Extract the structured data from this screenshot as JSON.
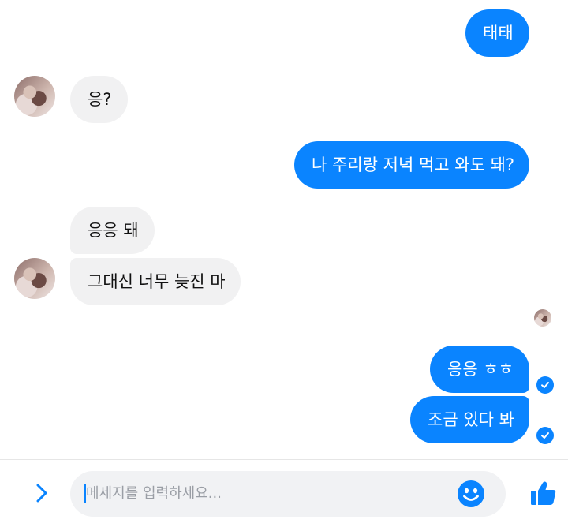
{
  "messages": [
    {
      "id": "m1",
      "direction": "outgoing",
      "text": "태태"
    },
    {
      "id": "m2",
      "direction": "incoming",
      "text": "응?"
    },
    {
      "id": "m3",
      "direction": "outgoing",
      "text": "나 주리랑 저녁 먹고 와도 돼?"
    },
    {
      "id": "m4",
      "direction": "incoming",
      "text": "응응 돼"
    },
    {
      "id": "m5",
      "direction": "incoming",
      "text": "그대신 너무 늦진 마"
    },
    {
      "id": "m6",
      "direction": "outgoing",
      "text": "응응 ㅎㅎ"
    },
    {
      "id": "m7",
      "direction": "outgoing",
      "text": "조금 있다 봐"
    }
  ],
  "composer": {
    "placeholder": "메세지를 입력하세요..."
  },
  "icons": {
    "expand": "chevron-right-icon",
    "emoji": "smiley-face-icon",
    "like": "thumbs-up-icon",
    "sent_status": "check-circle-icon"
  },
  "colors": {
    "outgoing_bubble": "#0a84ff",
    "incoming_bubble": "#f1f1f2",
    "accent": "#0a84ff"
  }
}
